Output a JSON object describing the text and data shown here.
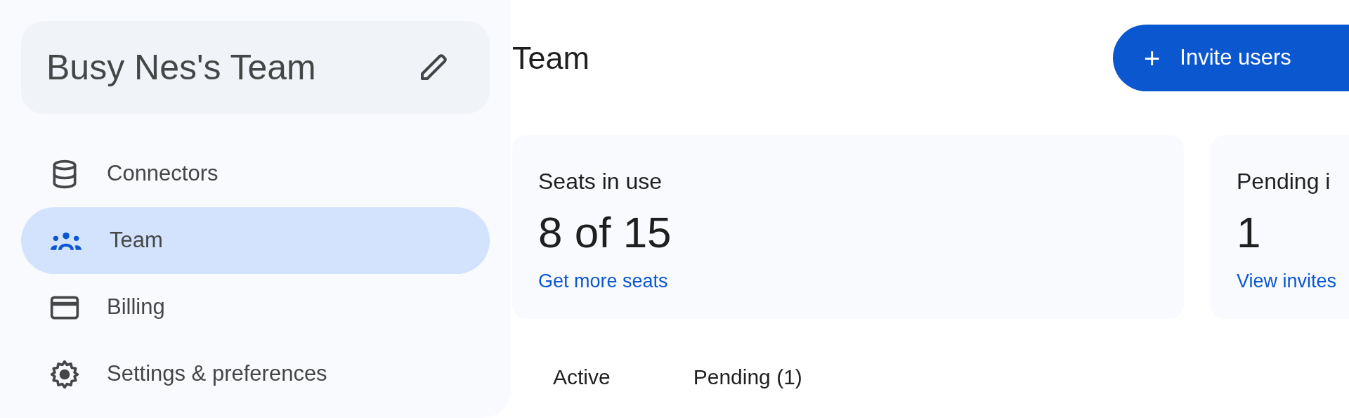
{
  "team_card": {
    "name": "Busy Nes's Team"
  },
  "sidebar": {
    "items": [
      {
        "label": "Connectors",
        "kind": "database",
        "selected": false
      },
      {
        "label": "Team",
        "kind": "people",
        "selected": true
      },
      {
        "label": "Billing",
        "kind": "card",
        "selected": false
      },
      {
        "label": "Settings & preferences",
        "kind": "gear",
        "selected": false
      }
    ]
  },
  "page": {
    "title": "Team",
    "invite_button": {
      "icon": "+",
      "label": "Invite users"
    }
  },
  "stats": [
    {
      "title": "Seats in use",
      "value": "8 of 15",
      "link": "Get more seats"
    },
    {
      "title": "Pending i",
      "value": "1",
      "link": "View invites"
    }
  ],
  "tabs": [
    {
      "label": "Active"
    },
    {
      "label": "Pending (1)"
    }
  ]
}
